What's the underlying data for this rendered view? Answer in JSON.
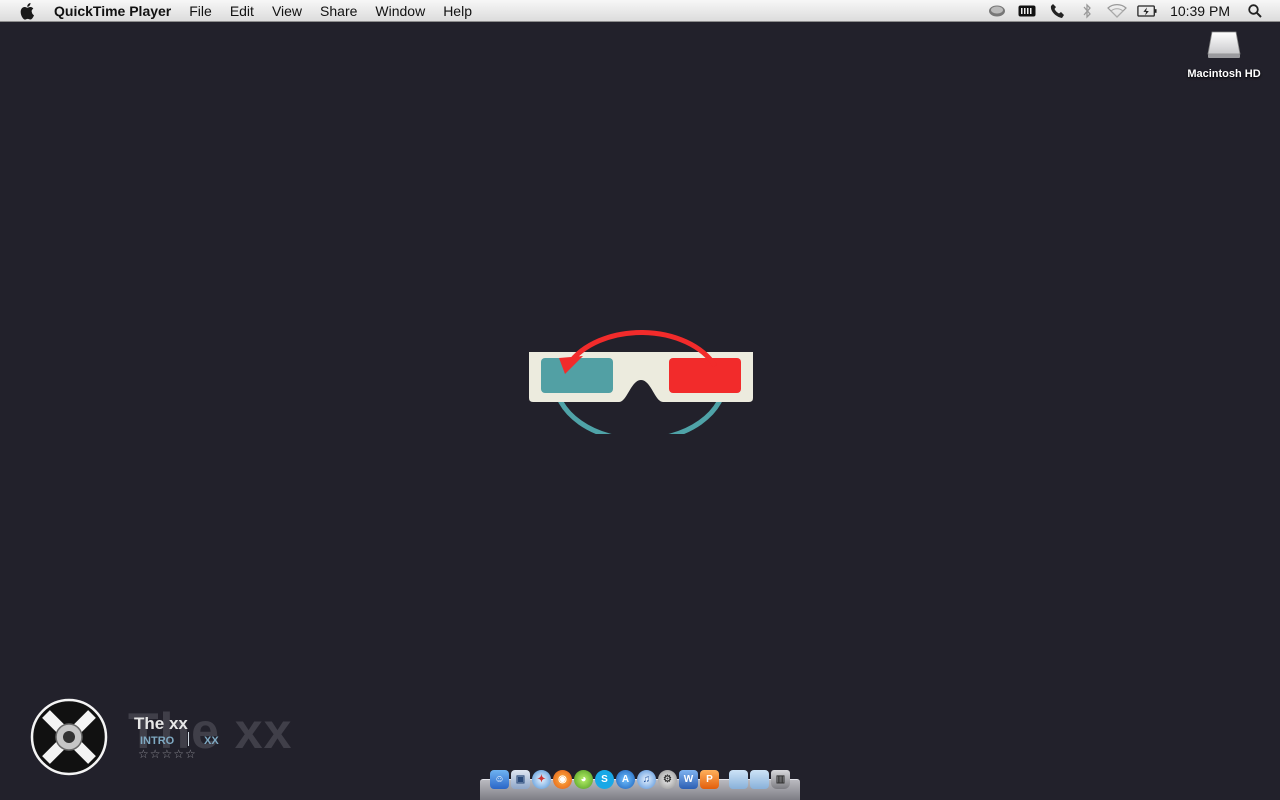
{
  "menubar": {
    "app_name": "QuickTime Player",
    "menus": [
      "File",
      "Edit",
      "View",
      "Share",
      "Window",
      "Help"
    ],
    "clock": "10:39 PM",
    "status_icons": [
      "time-machine-icon",
      "battery-icon",
      "phone-icon",
      "bluetooth-icon",
      "wifi-icon",
      "battery-charging-icon",
      "spotlight-search-icon"
    ]
  },
  "desktop": {
    "drive_label": "Macintosh HD",
    "background_color": "#22212b"
  },
  "now_playing": {
    "ghost_title": "The xx",
    "artist": "The xx",
    "song": "INTRO",
    "album": "XX",
    "rating_stars": "☆☆☆☆☆"
  },
  "dock": {
    "icons": [
      "finder-icon",
      "preview-icon",
      "safari-icon",
      "firefox-icon",
      "adium-icon",
      "skype-icon",
      "app-store-icon",
      "itunes-icon",
      "system-preferences-icon",
      "word-icon",
      "powerpoint-icon",
      "documents-folder-icon",
      "downloads-folder-icon",
      "trash-icon"
    ]
  }
}
